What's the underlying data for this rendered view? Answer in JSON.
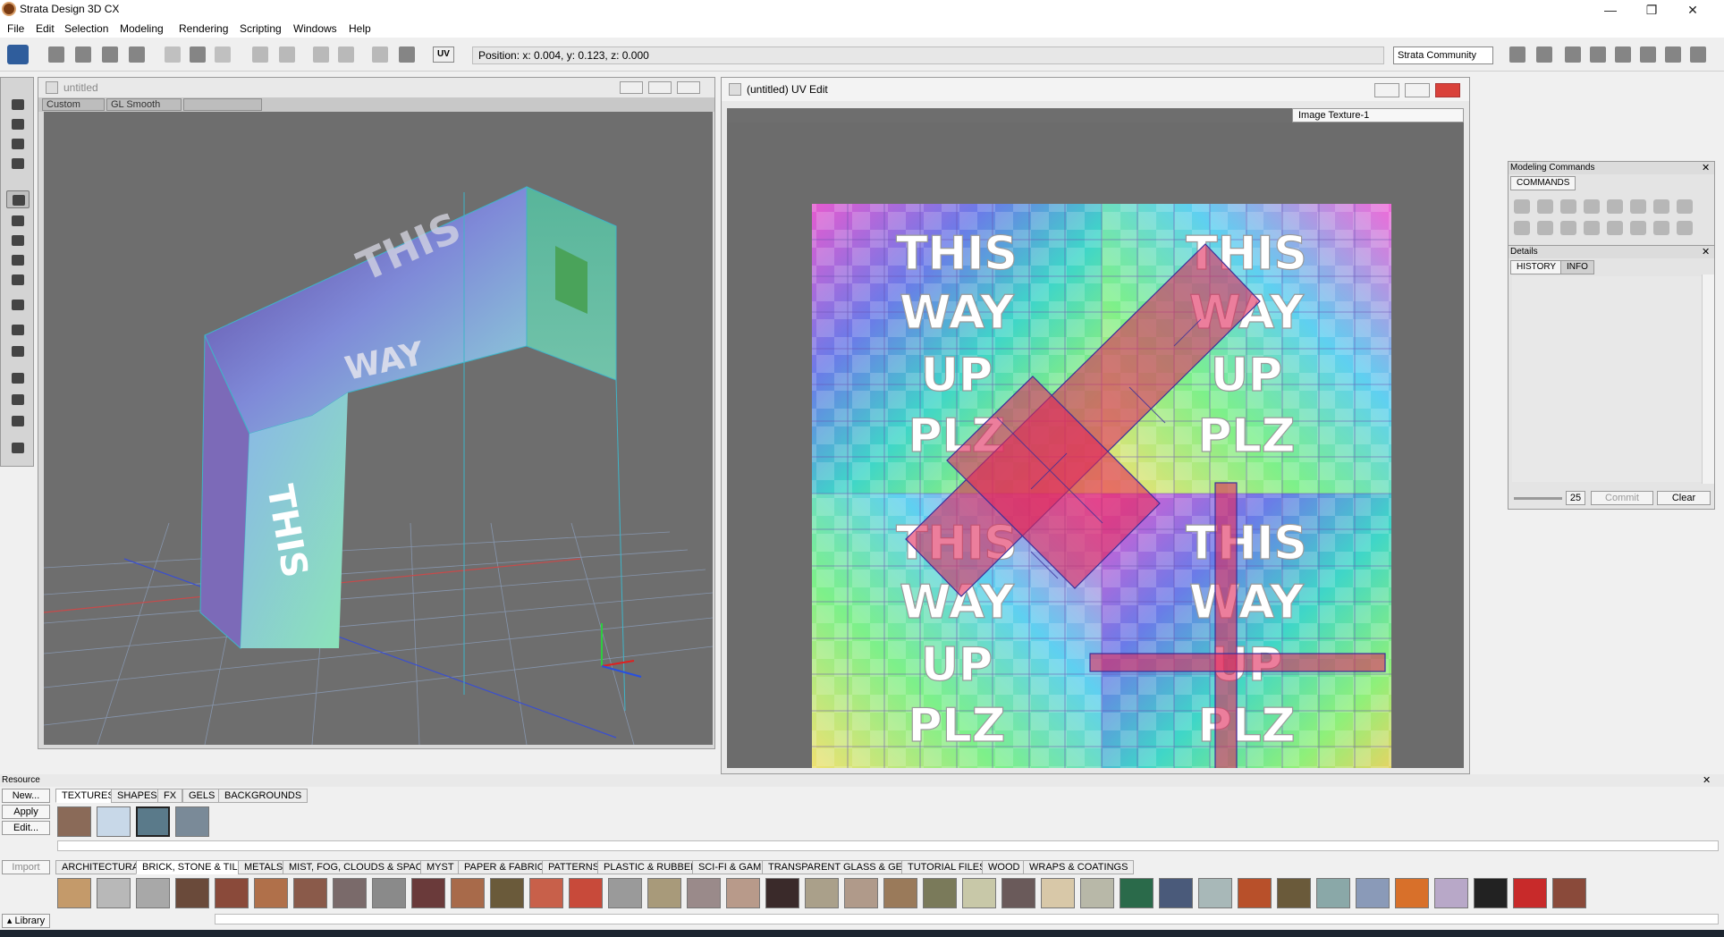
{
  "window": {
    "title": "Strata Design 3D CX",
    "controls": [
      "—",
      "❐",
      "✕"
    ]
  },
  "menu": [
    "File",
    "Edit",
    "Selection",
    "Modeling",
    "Rendering",
    "Scripting",
    "Windows",
    "Help"
  ],
  "toolbar": {
    "position_text": "Position:  x: 0.004,  y: 0.123,  z: 0.000",
    "uv_label": "UV",
    "preset": "Strata Community"
  },
  "model_window": {
    "title": "untitled",
    "shading_preset": "Custom",
    "render_mode": "GL Smooth"
  },
  "uv_window": {
    "title": "(untitled) UV Edit",
    "texture_select": "Image Texture-1",
    "texture_text": [
      "THIS",
      "WAY",
      "UP",
      "PLZ"
    ]
  },
  "modeling_commands": {
    "title": "Modeling Commands",
    "tab": "COMMANDS"
  },
  "details": {
    "title": "Details",
    "tabs": [
      "HISTORY",
      "INFO"
    ],
    "value": "25",
    "commit_label": "Commit",
    "clear_label": "Clear"
  },
  "resource": {
    "title": "Resource",
    "buttons": [
      "New...",
      "Apply",
      "Edit..."
    ],
    "import_label": "Import",
    "library_label": "▴ Library",
    "tabs": [
      "TEXTURES",
      "SHAPES",
      "FX",
      "GELS",
      "BACKGROUNDS"
    ],
    "categories": [
      "ARCHITECTURAL",
      "BRICK, STONE & TILE",
      "METALS",
      "MIST, FOG, CLOUDS & SPACE",
      "MYST",
      "PAPER & FABRIC",
      "PATTERNS",
      "PLASTIC & RUBBER",
      "SCI-FI & GAME",
      "TRANSPARENT GLASS & GEMS",
      "TUTORIAL FILES",
      "WOOD",
      "WRAPS & COATINGS"
    ]
  }
}
